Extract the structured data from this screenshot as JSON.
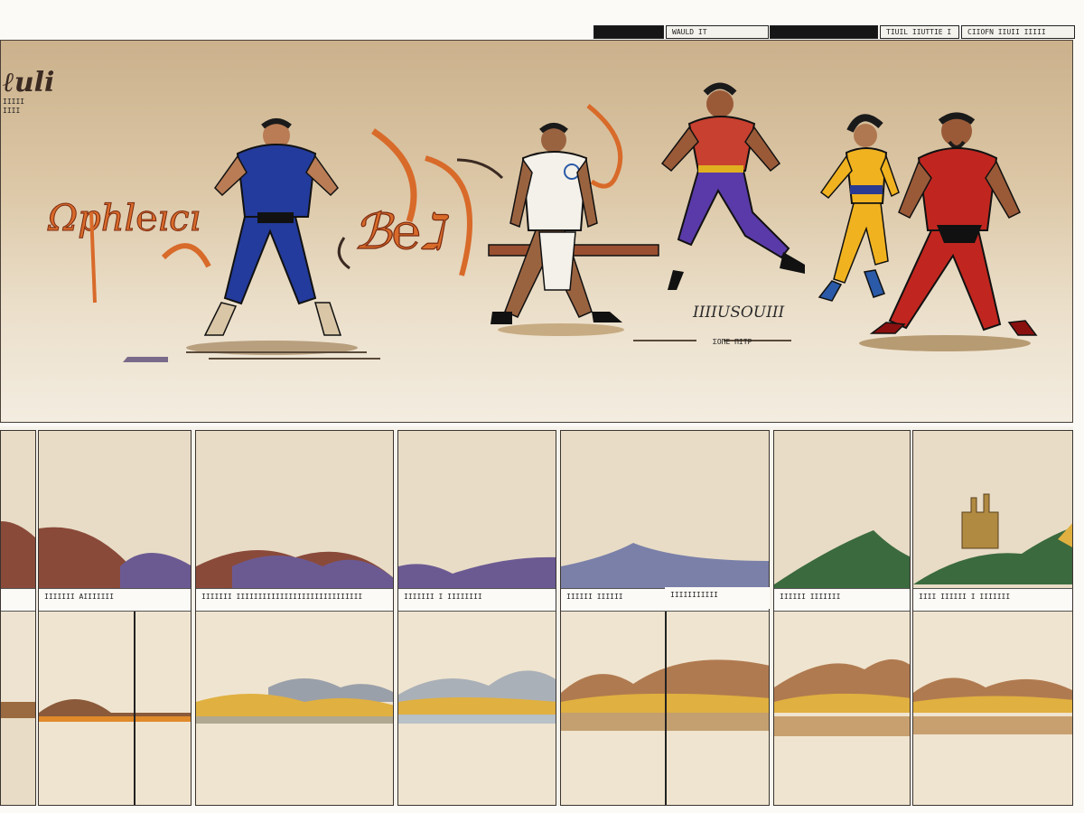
{
  "topbar": {
    "boxes": [
      {
        "style": "dark",
        "text": ""
      },
      {
        "style": "light",
        "text": "WAULD IT"
      },
      {
        "style": "dark",
        "text": ""
      },
      {
        "style": "light",
        "text": "TIUIL IIUTTIE I"
      },
      {
        "style": "light",
        "text": "CIIOFN IIUII IIIII"
      }
    ]
  },
  "hero": {
    "logo_script": "ℓuli",
    "logo_small_1": "IIIII",
    "logo_small_2": "IIII",
    "sound_effect_left": "Ωphl℮ıcı",
    "sound_effect_center": "ℬ℮ℷ",
    "caption_right": "IIIIUSOUIII",
    "subcaption_right": "ΣΟΠΕ ΠΙΤΡ"
  },
  "characters": [
    {
      "name": "blue-suit-strongman",
      "suit": "#233b9c"
    },
    {
      "name": "white-tunic-strongman",
      "suit": "#f4f1ea"
    },
    {
      "name": "red-purple-strongman",
      "suit": "#c8402f"
    },
    {
      "name": "yellow-suit-heroine",
      "suit": "#f0b21f"
    },
    {
      "name": "red-suit-strongman",
      "suit": "#c0261f"
    }
  ],
  "panels": [
    {
      "caption": ""
    },
    {
      "caption": "IIIIIII  AIIIIIII"
    },
    {
      "caption": "IIIIIII  IIIIIIIIIIIIIIIIIIIIIIIIIIIII"
    },
    {
      "caption": "IIIIIII  I  IIIIIIII"
    },
    {
      "caption": "IIIIII IIIIII"
    },
    {
      "caption": "IIIIIIIIIII"
    },
    {
      "caption": "IIIIII  IIIIIII"
    },
    {
      "caption": "IIII IIIIII  I  IIIIIII"
    }
  ],
  "colors": {
    "sky": "#e8dcc6",
    "mountain_brown": "#8a4a3a",
    "mountain_purple": "#6b5a92",
    "hill_green": "#3b6a3e",
    "accent_orange": "#d86a2a"
  }
}
